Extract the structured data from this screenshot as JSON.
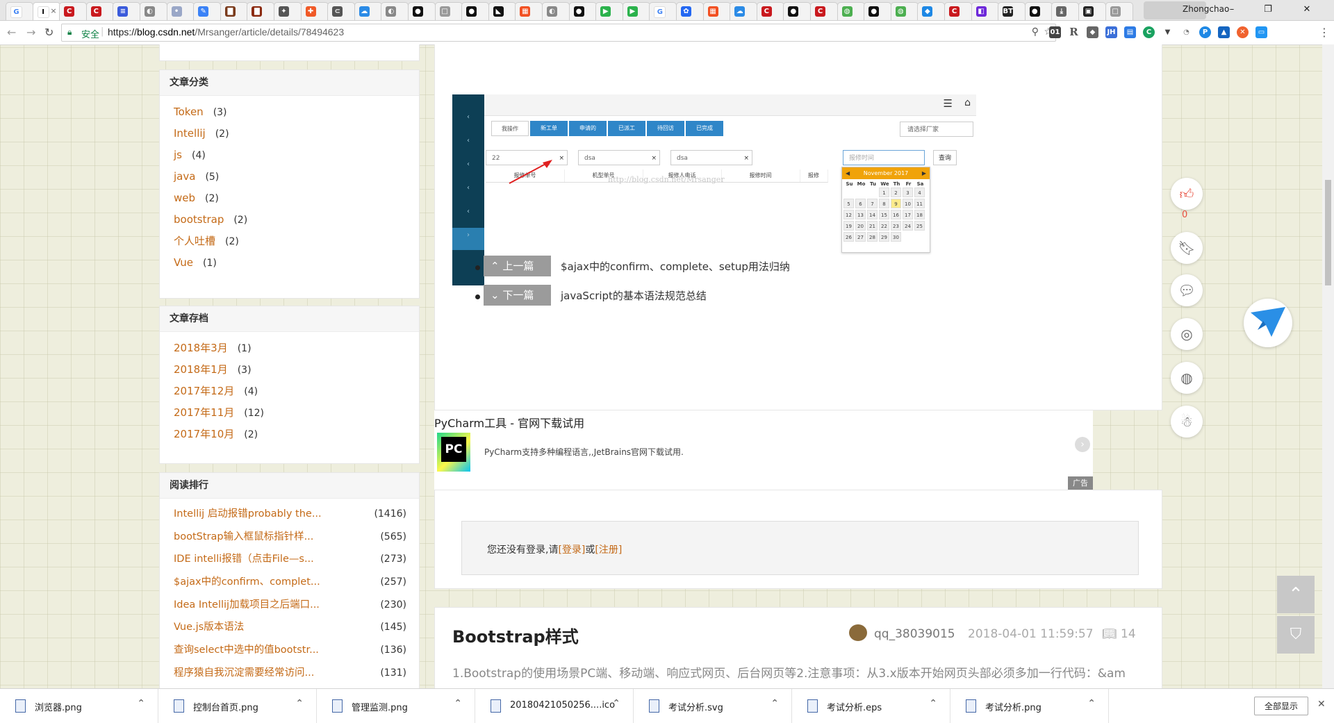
{
  "browser": {
    "tabs": [
      {
        "icon": "G",
        "color": "#fff",
        "fg": "#4285f4"
      },
      {
        "icon": "I",
        "color": "#fff",
        "fg": "#000",
        "active": true,
        "close": "×"
      },
      {
        "icon": "C",
        "color": "#c9191e"
      },
      {
        "icon": "C",
        "color": "#c9191e"
      },
      {
        "icon": "≡",
        "color": "#3b5bdb"
      },
      {
        "icon": "◐",
        "color": "#888"
      },
      {
        "icon": "•",
        "color": "#9aa7c7"
      },
      {
        "icon": "✎",
        "color": "#3b82f6"
      },
      {
        "icon": "▇",
        "color": "#7a3b1c"
      },
      {
        "icon": "▇",
        "color": "#8b2a10"
      },
      {
        "icon": "✦",
        "color": "#555"
      },
      {
        "icon": "✚",
        "color": "#f05a28"
      },
      {
        "icon": "⊂",
        "color": "#555"
      },
      {
        "icon": "☁",
        "color": "#2b8be6"
      },
      {
        "icon": "◐",
        "color": "#888"
      },
      {
        "icon": "●",
        "color": "#111"
      },
      {
        "icon": "□",
        "color": "#999"
      },
      {
        "icon": "●",
        "color": "#111"
      },
      {
        "icon": "◣",
        "color": "#111"
      },
      {
        "icon": "▦",
        "color": "#f25022"
      },
      {
        "icon": "◐",
        "color": "#888"
      },
      {
        "icon": "●",
        "color": "#111"
      },
      {
        "icon": "▶",
        "color": "#2bb24c"
      },
      {
        "icon": "▶",
        "color": "#2bb24c"
      },
      {
        "icon": "G",
        "color": "#fff",
        "fg": "#4285f4"
      },
      {
        "icon": "✿",
        "color": "#2468f2"
      },
      {
        "icon": "▦",
        "color": "#f25022"
      },
      {
        "icon": "☁",
        "color": "#2b8be6"
      },
      {
        "icon": "C",
        "color": "#c9191e"
      },
      {
        "icon": "●",
        "color": "#111"
      },
      {
        "icon": "C",
        "color": "#c9191e"
      },
      {
        "icon": "◍",
        "color": "#4caf50"
      },
      {
        "icon": "●",
        "color": "#111"
      },
      {
        "icon": "◍",
        "color": "#4caf50"
      },
      {
        "icon": "◆",
        "color": "#1e88e5"
      },
      {
        "icon": "C",
        "color": "#c9191e"
      },
      {
        "icon": "◧",
        "color": "#6d28d9"
      },
      {
        "icon": "BT",
        "color": "#222"
      },
      {
        "icon": "●",
        "color": "#111"
      },
      {
        "icon": "⤓",
        "color": "#666"
      },
      {
        "icon": "▣",
        "color": "#222"
      },
      {
        "icon": "□",
        "color": "#999"
      }
    ],
    "profile_name": "Zhongchao",
    "window_buttons": [
      "–",
      "❐",
      "✕"
    ],
    "secure_label": "安全",
    "url_scheme": "https://",
    "url_host": "blog.csdn.net",
    "url_path": "/Mrsanger/article/details/78494623"
  },
  "sidebar": {
    "categories_title": "文章分类",
    "categories": [
      {
        "name": "Token",
        "count": "(3)"
      },
      {
        "name": "Intellij",
        "count": "(2)"
      },
      {
        "name": "js",
        "count": "(4)"
      },
      {
        "name": "java",
        "count": "(5)"
      },
      {
        "name": "web",
        "count": "(2)"
      },
      {
        "name": "bootstrap",
        "count": "(2)"
      },
      {
        "name": "个人吐槽",
        "count": "(2)"
      },
      {
        "name": "Vue",
        "count": "(1)"
      }
    ],
    "archive_title": "文章存档",
    "archive": [
      {
        "name": "2018年3月",
        "count": "(1)"
      },
      {
        "name": "2018年1月",
        "count": "(3)"
      },
      {
        "name": "2017年12月",
        "count": "(4)"
      },
      {
        "name": "2017年11月",
        "count": "(12)"
      },
      {
        "name": "2017年10月",
        "count": "(2)"
      }
    ],
    "ranking_title": "阅读排行",
    "ranking": [
      {
        "name": "Intellij 启动报错probably the...",
        "count": "(1416)"
      },
      {
        "name": "bootStrap输入框鼠标指针样...",
        "count": "(565)"
      },
      {
        "name": "IDE intelli报错（点击File—s...",
        "count": "(273)"
      },
      {
        "name": "$ajax中的confirm、complet...",
        "count": "(257)"
      },
      {
        "name": "Idea Intellij加载项目之后端口...",
        "count": "(230)"
      },
      {
        "name": "Vue.js版本语法",
        "count": "(145)"
      },
      {
        "name": "查询select中选中的值bootstr...",
        "count": "(136)"
      },
      {
        "name": "程序猿自我沉淀需要经常访问...",
        "count": "(131)"
      }
    ]
  },
  "screenshot": {
    "tabs": [
      "我操作",
      "新工单",
      "申请的",
      "已派工",
      "待回访",
      "已完成"
    ],
    "vendor_placeholder": "请选择厂家",
    "inputs": [
      "22",
      "dsa",
      "dsa"
    ],
    "time_placeholder": "报修时间",
    "query_btn": "查询",
    "columns": [
      "报修单号",
      "机型单号",
      "报修人电话",
      "报修时间",
      "报修"
    ],
    "watermark": "http://blog.csdn.net/Mrsanger",
    "calendar": {
      "month": "November 2017",
      "days": [
        "Su",
        "Mo",
        "Tu",
        "We",
        "Th",
        "Fr",
        "Sa"
      ],
      "weeks": [
        [
          "",
          "",
          "",
          "1",
          "2",
          "3",
          "4"
        ],
        [
          "5",
          "6",
          "7",
          "8",
          "9",
          "10",
          "11"
        ],
        [
          "12",
          "13",
          "14",
          "15",
          "16",
          "17",
          "18"
        ],
        [
          "19",
          "20",
          "21",
          "22",
          "23",
          "24",
          "25"
        ],
        [
          "26",
          "27",
          "28",
          "29",
          "30",
          "",
          ""
        ]
      ],
      "today": "9"
    }
  },
  "article_nav": {
    "prev_label": "上一篇",
    "prev_title": "$ajax中的confirm、complete、setup用法归纳",
    "next_label": "下一篇",
    "next_title": "javaScript的基本语法规范总结"
  },
  "ad": {
    "title": "PyCharm工具 - 官网下载试用",
    "logo_text": "PC",
    "desc": "PyCharm支持多种编程语言,,JetBrains官网下载试用.",
    "tag": "广告"
  },
  "login": {
    "prefix": "您还没有登录,请",
    "login_link": "[登录]",
    "or": "或",
    "register_link": "[注册]"
  },
  "next_article": {
    "title": "Bootstrap样式",
    "author": "qq_38039015",
    "date": "2018-04-01 11:59:57",
    "views": "14",
    "excerpt": "1.Bootstrap的使用场景PC端、移动端、响应式网页、后台网页等2.注意事项：从3.x版本开始网页头部必须多加一行代码：&am"
  },
  "float_bar": {
    "like_count": "0"
  },
  "downloads": [
    {
      "name": "浏览器.png"
    },
    {
      "name": "控制台首页.png"
    },
    {
      "name": "管理监测.png"
    },
    {
      "name": "20180421050256....ico"
    },
    {
      "name": "考试分析.svg"
    },
    {
      "name": "考试分析.eps"
    },
    {
      "name": "考试分析.png"
    }
  ],
  "show_all_label": "全部显示"
}
